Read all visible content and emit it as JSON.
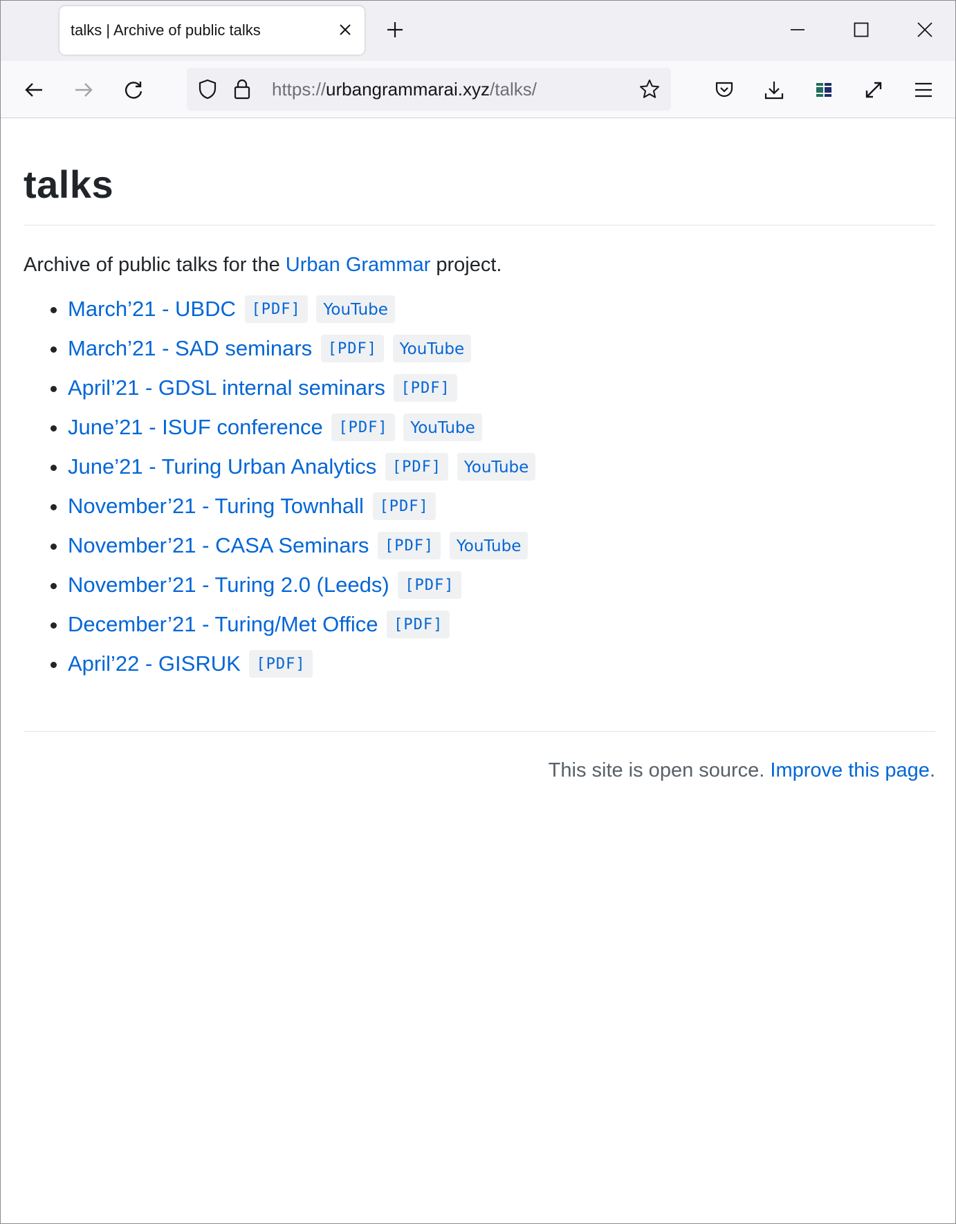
{
  "browser": {
    "tab_title": "talks | Archive of public talks",
    "url_scheme": "https://",
    "url_domain": "urbangrammarai.xyz",
    "url_path": "/talks/"
  },
  "page": {
    "title": "talks",
    "intro_prefix": "Archive of public talks for the ",
    "intro_link": "Urban Grammar",
    "intro_suffix": " project.",
    "talks": [
      {
        "title": "March’21 - UBDC",
        "pdf": "[PDF]",
        "youtube": "YouTube"
      },
      {
        "title": "March’21 - SAD seminars",
        "pdf": "[PDF]",
        "youtube": "YouTube"
      },
      {
        "title": "April’21 - GDSL internal seminars",
        "pdf": "[PDF]"
      },
      {
        "title": "June’21 - ISUF conference",
        "pdf": "[PDF]",
        "youtube": "YouTube"
      },
      {
        "title": "June’21 - Turing Urban Analytics",
        "pdf": "[PDF]",
        "youtube": "YouTube"
      },
      {
        "title": "November’21 - Turing Townhall",
        "pdf": "[PDF]"
      },
      {
        "title": "November’21 - CASA Seminars",
        "pdf": "[PDF]",
        "youtube": "YouTube"
      },
      {
        "title": "November’21 - Turing 2.0 (Leeds)",
        "pdf": "[PDF]"
      },
      {
        "title": "December’21 - Turing/Met Office",
        "pdf": "[PDF]"
      },
      {
        "title": "April’22 - GISRUK",
        "pdf": "[PDF]"
      }
    ],
    "footer_text": "This site is open source. ",
    "footer_link": "Improve this page",
    "footer_end": "."
  },
  "colors": {
    "link": "#0366d6",
    "text": "#212529"
  }
}
